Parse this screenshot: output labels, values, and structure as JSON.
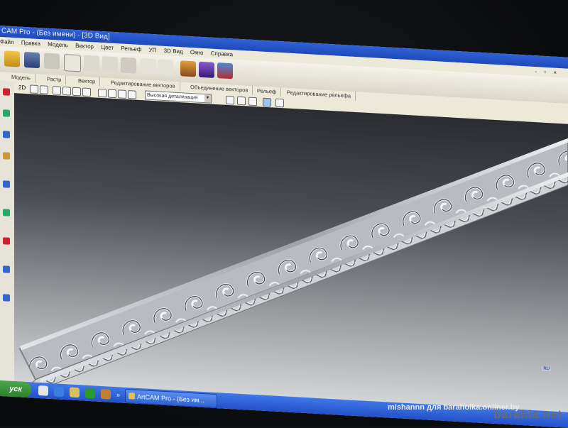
{
  "window": {
    "title": "CAM Pro - (Без имени) - [3D Вид]"
  },
  "menu": {
    "items": [
      "Файл",
      "Правка",
      "Модель",
      "Вектор",
      "Цвет",
      "Рельеф",
      "УП",
      "3D Вид",
      "Окно",
      "Справка"
    ],
    "mdi_controls": "- ▫ ×"
  },
  "tabs": [
    "Модель",
    "Растр",
    "Вектор",
    "Редактирование векторов",
    "Объединение векторов",
    "Рельеф",
    "Редактирование рельефа"
  ],
  "view_toolbar": {
    "mode": "2D",
    "detail_select": "Высокая детализация"
  },
  "taskbar": {
    "start_label": "уск",
    "chevron": "»",
    "task_label": "ArtCAM Pro - (Без им...",
    "language": "RU"
  },
  "watermark": "mishannn для baraholka.onliner.by",
  "logo": "barahla net",
  "colors": {
    "title_blue": "#2f62d8",
    "taskbar_blue": "#2f5ed6",
    "start_green": "#3c9a3c"
  }
}
